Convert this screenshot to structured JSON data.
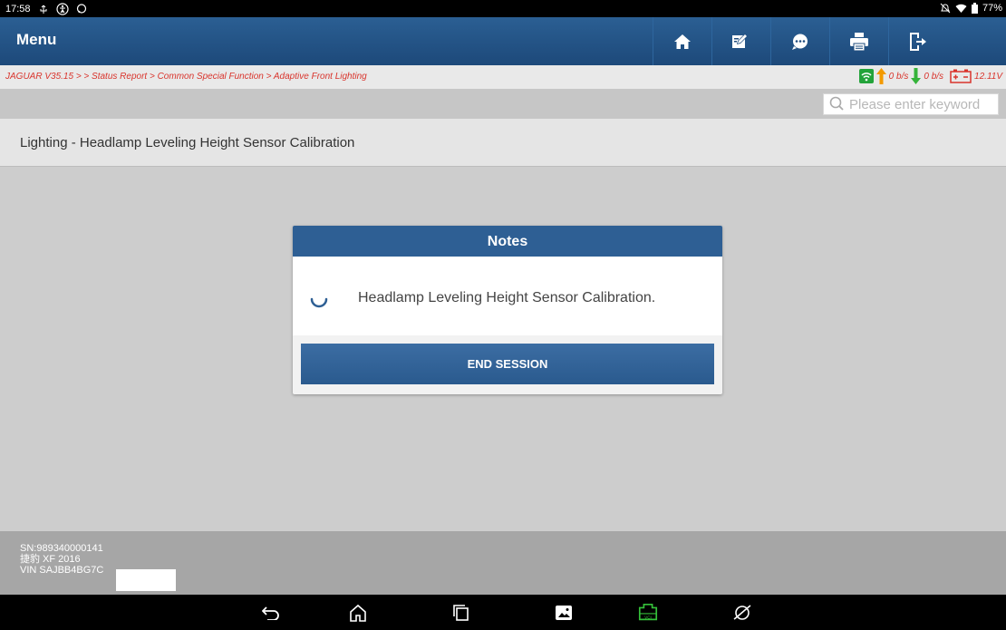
{
  "status_bar": {
    "time": "17:58",
    "battery": "77%",
    "left_icons": [
      "usb-icon",
      "accessibility-icon",
      "chat-bubble-icon"
    ],
    "right_icons": [
      "alarm-off-icon",
      "wifi-icon",
      "battery-icon"
    ]
  },
  "header": {
    "title": "Menu",
    "toolbar": [
      "home-icon",
      "edit-icon",
      "message-icon",
      "print-icon",
      "exit-icon"
    ]
  },
  "breadcrumb": {
    "text": "JAGUAR V35.15 > > Status Report > Common Special Function > Adaptive Front Lighting"
  },
  "indicators": {
    "upload": "0 b/s",
    "download": "0 b/s",
    "voltage": "12.11V"
  },
  "search": {
    "placeholder": "Please enter keyword"
  },
  "page": {
    "heading": "Lighting - Headlamp Leveling Height Sensor Calibration"
  },
  "dialog": {
    "title": "Notes",
    "message": "Headlamp Leveling Height Sensor Calibration.",
    "button": "END SESSION"
  },
  "footer": {
    "sn": "SN:989340000141",
    "vehicle": "捷豹 XF 2016",
    "vin": "VIN SAJBB4BG7C"
  },
  "nav_bar": {
    "icons": [
      "back-icon",
      "home-nav-icon",
      "recent-apps-icon",
      "gallery-icon",
      "vci-icon",
      "browser-icon"
    ]
  },
  "colors": {
    "header_blue": "#1f4c7e",
    "breadcrumb_red": "#d9342c",
    "vci_green": "#35c13a",
    "signal_green": "#23a33a",
    "upload_orange": "#f39a00"
  }
}
